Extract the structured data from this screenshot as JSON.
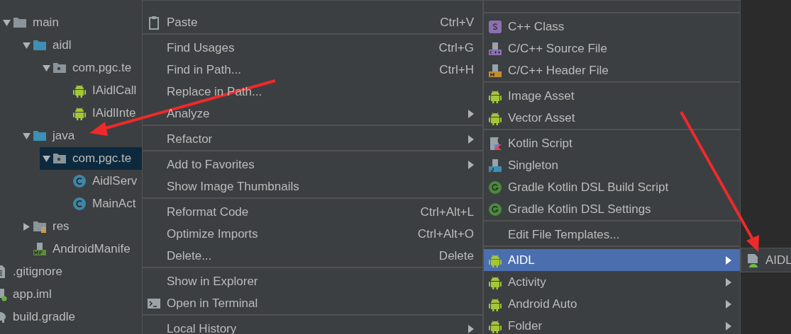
{
  "project_tree": [
    {
      "children": [
        {
          "label": "main",
          "kind": "folder",
          "expanded": true,
          "children": [
            {
              "label": "aidl",
              "kind": "source-folder",
              "expanded": true,
              "children": [
                {
                  "label": "com.pgc.te",
                  "kind": "package",
                  "expanded": true,
                  "selected": false,
                  "children": [
                    {
                      "label": "IAidlCall",
                      "kind": "android"
                    },
                    {
                      "label": "IAidlInte",
                      "kind": "android"
                    }
                  ]
                }
              ]
            },
            {
              "label": "java",
              "kind": "source-folder",
              "expanded": true,
              "children": [
                {
                  "label": "com.pgc.te",
                  "kind": "package",
                  "expanded": true,
                  "selected": true,
                  "children": [
                    {
                      "label": "AidlServ",
                      "kind": "class"
                    },
                    {
                      "label": "MainAct",
                      "kind": "class"
                    }
                  ]
                }
              ]
            },
            {
              "label": "res",
              "kind": "res-folder",
              "expanded": false
            },
            {
              "label": "AndroidManife",
              "kind": "manifest"
            }
          ]
        }
      ]
    },
    {
      "label": ".gitignore",
      "kind": "text-file"
    },
    {
      "label": "app.iml",
      "kind": "module-file"
    },
    {
      "label": "build.gradle",
      "kind": "gradle"
    }
  ],
  "context_menu": [
    {
      "kind": "clipboard",
      "label": "Paste",
      "shortcut": "Ctrl+V"
    },
    {
      "kind": "separator"
    },
    {
      "kind": "plain",
      "label": "Find Usages",
      "shortcut": "Ctrl+G"
    },
    {
      "kind": "plain",
      "label": "Find in Path...",
      "shortcut": "Ctrl+H"
    },
    {
      "kind": "plain",
      "label": "Replace in Path..."
    },
    {
      "kind": "plain",
      "label": "Analyze",
      "submenu": true
    },
    {
      "kind": "separator"
    },
    {
      "kind": "plain",
      "label": "Refactor",
      "submenu": true
    },
    {
      "kind": "separator"
    },
    {
      "kind": "plain",
      "label": "Add to Favorites",
      "submenu": true
    },
    {
      "kind": "plain",
      "label": "Show Image Thumbnails"
    },
    {
      "kind": "separator"
    },
    {
      "kind": "plain",
      "label": "Reformat Code",
      "shortcut": "Ctrl+Alt+L"
    },
    {
      "kind": "plain",
      "label": "Optimize Imports",
      "shortcut": "Ctrl+Alt+O"
    },
    {
      "kind": "plain",
      "label": "Delete...",
      "shortcut": "Delete"
    },
    {
      "kind": "separator"
    },
    {
      "kind": "plain",
      "label": "Show in Explorer"
    },
    {
      "kind": "terminal",
      "label": "Open in Terminal"
    },
    {
      "kind": "separator"
    },
    {
      "kind": "plain",
      "label": "Local History",
      "submenu": true
    }
  ],
  "new_submenu": [
    {
      "kind": "separator"
    },
    {
      "kind": "cpp-class",
      "label": "C++ Class",
      "selected": false
    },
    {
      "kind": "cpp-file",
      "label": "C/C++ Source File",
      "selected": false
    },
    {
      "kind": "header-file",
      "label": "C/C++ Header File",
      "selected": false
    },
    {
      "kind": "separator"
    },
    {
      "kind": "android",
      "label": "Image Asset",
      "selected": false
    },
    {
      "kind": "android",
      "label": "Vector Asset",
      "selected": false
    },
    {
      "kind": "separator"
    },
    {
      "kind": "kotlin",
      "label": "Kotlin Script",
      "selected": false
    },
    {
      "kind": "singleton",
      "label": "Singleton",
      "selected": false
    },
    {
      "kind": "gradle-g",
      "label": "Gradle Kotlin DSL Build Script",
      "selected": false
    },
    {
      "kind": "gradle-g",
      "label": "Gradle Kotlin DSL Settings",
      "selected": false
    },
    {
      "kind": "separator"
    },
    {
      "kind": "plain",
      "label": "Edit File Templates...",
      "selected": false
    },
    {
      "kind": "separator"
    },
    {
      "kind": "android",
      "label": "AIDL",
      "submenu": true,
      "selected": true
    },
    {
      "kind": "android",
      "label": "Activity",
      "submenu": true,
      "selected": false
    },
    {
      "kind": "android",
      "label": "Android Auto",
      "submenu": true,
      "selected": false
    },
    {
      "kind": "android",
      "label": "Folder",
      "submenu": true,
      "selected": false
    }
  ],
  "aidl_submenu": [
    {
      "kind": "aidl-file",
      "label": "AIDL",
      "selected": false
    }
  ]
}
